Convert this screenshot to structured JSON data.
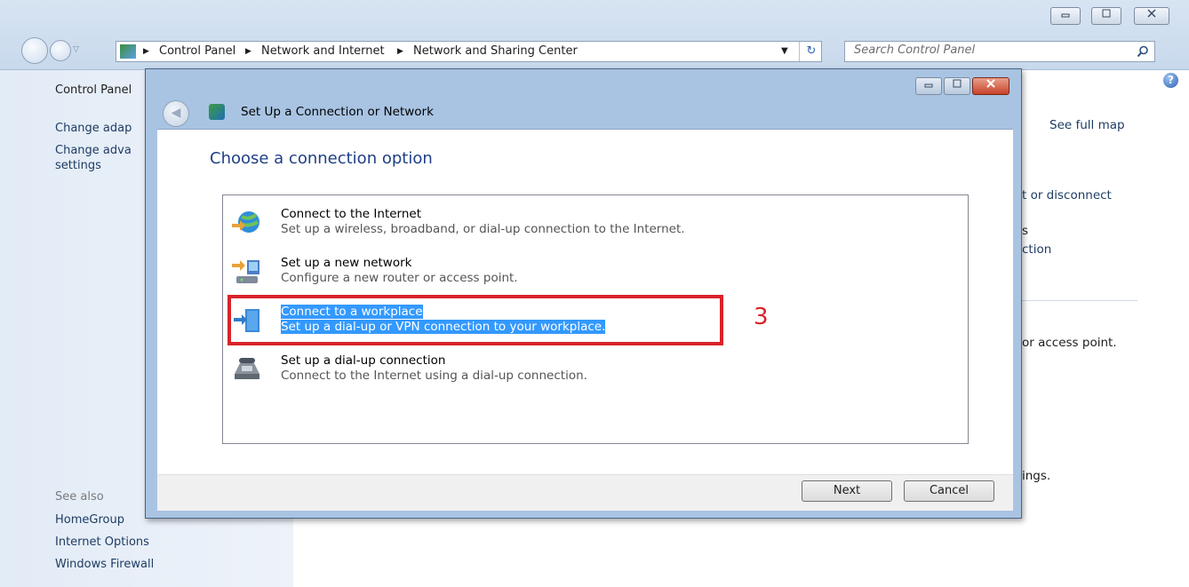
{
  "explorer": {
    "breadcrumb": [
      "Control Panel",
      "Network and Internet",
      "Network and Sharing Center"
    ],
    "search_placeholder": "Search Control Panel",
    "left_pane": {
      "items": [
        "Control Panel",
        "Change adap",
        "Change adva",
        "settings"
      ],
      "see_also_label": "See also",
      "see_also": [
        "HomeGroup",
        "Internet Options",
        "Windows Firewall"
      ]
    },
    "right_fragments": {
      "see_full_map": "See full map",
      "connect_disconnect": "t or disconnect",
      "frag_s": "s",
      "frag_ction": "ction",
      "access_point": "or access point.",
      "ings": "ings."
    }
  },
  "dialog": {
    "title": "Set Up a Connection or Network",
    "heading": "Choose a connection option",
    "options": [
      {
        "title": "Connect to the Internet",
        "desc": "Set up a wireless, broadband, or dial-up connection to the Internet.",
        "icon": "globe-network-icon"
      },
      {
        "title": "Set up a new network",
        "desc": "Configure a new router or access point.",
        "icon": "router-network-icon"
      },
      {
        "title": "Connect to a workplace",
        "desc": "Set up a dial-up or VPN connection to your workplace.",
        "icon": "workplace-icon",
        "selected": true
      },
      {
        "title": "Set up a dial-up connection",
        "desc": "Connect to the Internet using a dial-up connection.",
        "icon": "telephone-modem-icon"
      }
    ],
    "next_label": "Next",
    "cancel_label": "Cancel",
    "annotation_step": "3"
  },
  "colors": {
    "annotation_red": "#d9232a",
    "selection_blue": "#3399ff"
  }
}
